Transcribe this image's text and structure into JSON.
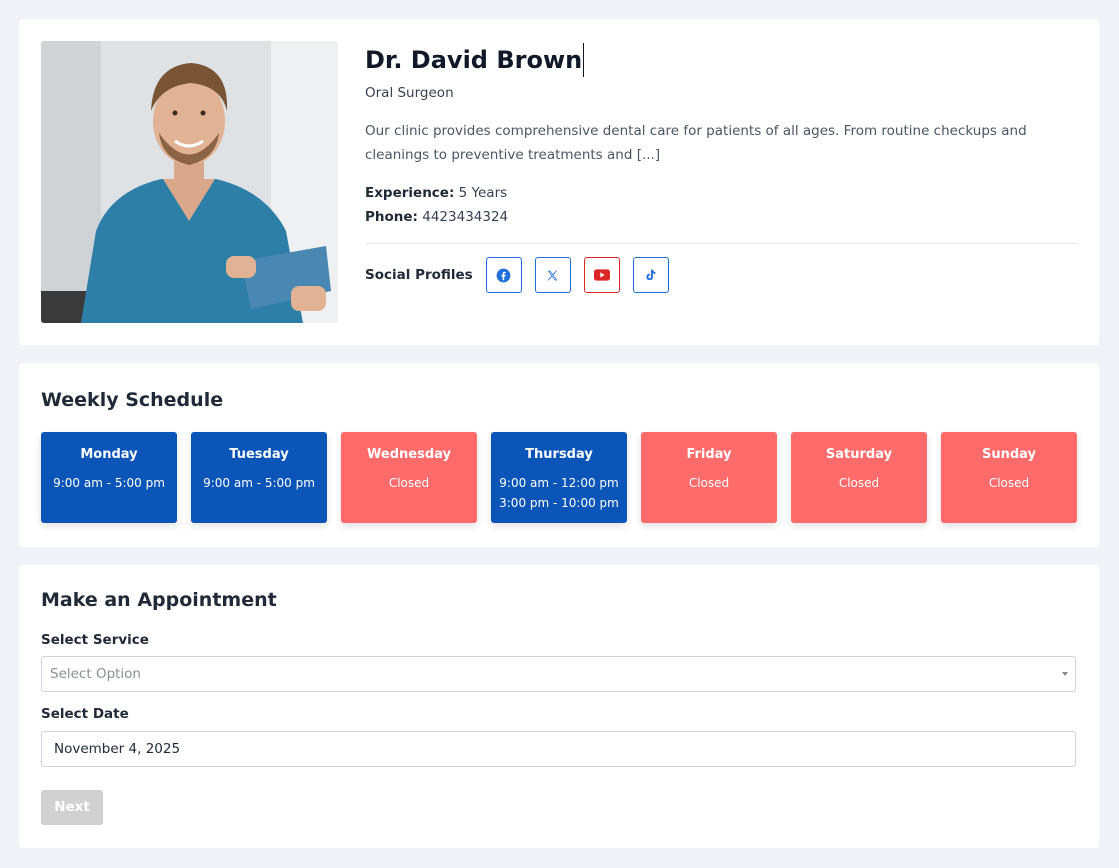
{
  "doctor": {
    "name": "Dr. David Brown",
    "specialty": "Oral Surgeon",
    "bio": "Our clinic provides comprehensive dental care for patients of all ages. From routine checkups and cleanings to preventive treatments and [...]",
    "experience_label": "Experience:",
    "experience_value": "5 Years",
    "phone_label": "Phone:",
    "phone_value": "4423434324"
  },
  "social": {
    "label": "Social Profiles",
    "items": [
      {
        "name": "facebook-icon",
        "color": "#1e6fd9"
      },
      {
        "name": "x-icon",
        "color": "#1e6fd9"
      },
      {
        "name": "youtube-icon",
        "color": "#dc2626"
      },
      {
        "name": "tiktok-icon",
        "color": "#1e6fd9"
      }
    ]
  },
  "schedule": {
    "title": "Weekly Schedule",
    "days": [
      {
        "day": "Monday",
        "hours": [
          "9:00 am - 5:00 pm"
        ],
        "status": "open"
      },
      {
        "day": "Tuesday",
        "hours": [
          "9:00 am - 5:00 pm"
        ],
        "status": "open"
      },
      {
        "day": "Wednesday",
        "hours": [
          "Closed"
        ],
        "status": "closed"
      },
      {
        "day": "Thursday",
        "hours": [
          "9:00 am - 12:00 pm",
          "3:00 pm - 10:00 pm"
        ],
        "status": "open"
      },
      {
        "day": "Friday",
        "hours": [
          "Closed"
        ],
        "status": "closed"
      },
      {
        "day": "Saturday",
        "hours": [
          "Closed"
        ],
        "status": "closed"
      },
      {
        "day": "Sunday",
        "hours": [
          "Closed"
        ],
        "status": "closed"
      }
    ],
    "colors": {
      "open": "#0b55b8",
      "closed": "#ff6b6b"
    }
  },
  "appointment": {
    "title": "Make an Appointment",
    "service_label": "Select Service",
    "service_placeholder": "Select Option",
    "date_label": "Select Date",
    "date_value": "November 4, 2025",
    "next_label": "Next"
  }
}
